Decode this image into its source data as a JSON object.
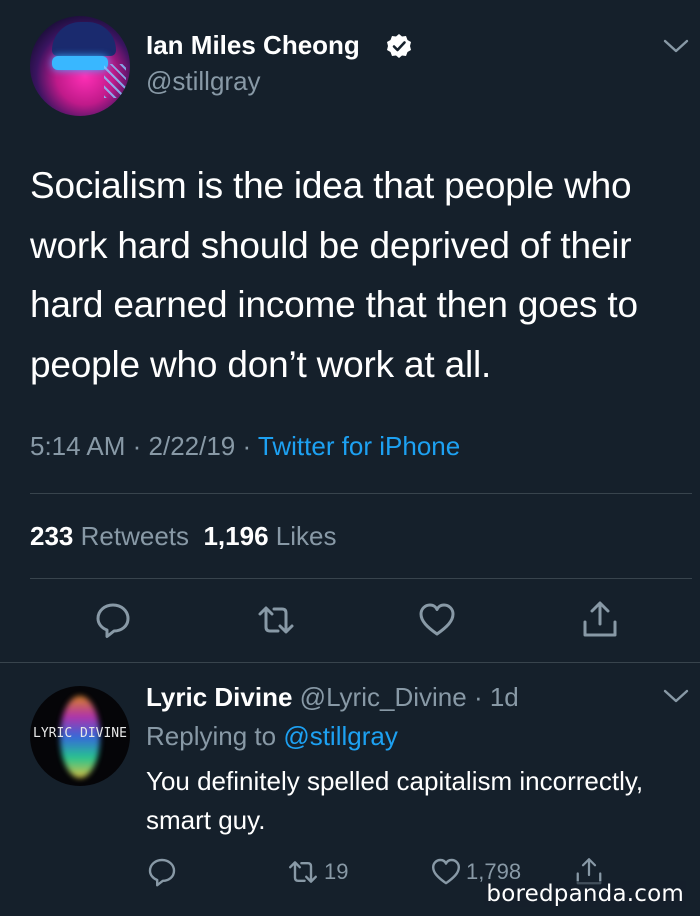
{
  "tweet": {
    "author_name": "Ian Miles Cheong",
    "author_handle": "@stillgray",
    "text": "Socialism is the idea that people who work hard should be deprived of their hard earned income that then goes to people who don’t work at all.",
    "time": "5:14 AM",
    "date": "2/22/19",
    "source": "Twitter for iPhone",
    "retweet_count": "233",
    "retweets_label": "Retweets",
    "like_count": "1,196",
    "likes_label": "Likes"
  },
  "reply": {
    "author_name": "Lyric Divine",
    "author_handle": "@Lyric_Divine",
    "age": "1d",
    "replying_label": "Replying to",
    "replying_handle": "@stillgray",
    "text": "You definitely spelled capitalism incorrectly, smart guy.",
    "avatar_text": "LYRIC DIVINE",
    "retweet_count": "19",
    "like_count": "1,798"
  },
  "watermark": "boredpanda.com",
  "icons": {
    "verified": "verified-badge-icon",
    "chevron": "chevron-down-icon",
    "reply": "reply-icon",
    "retweet": "retweet-icon",
    "like": "heart-icon",
    "share": "share-icon"
  },
  "colors": {
    "background": "#15202b",
    "text": "#ffffff",
    "muted": "#8899a6",
    "accent": "#1da1f2",
    "divider": "#38444d"
  }
}
